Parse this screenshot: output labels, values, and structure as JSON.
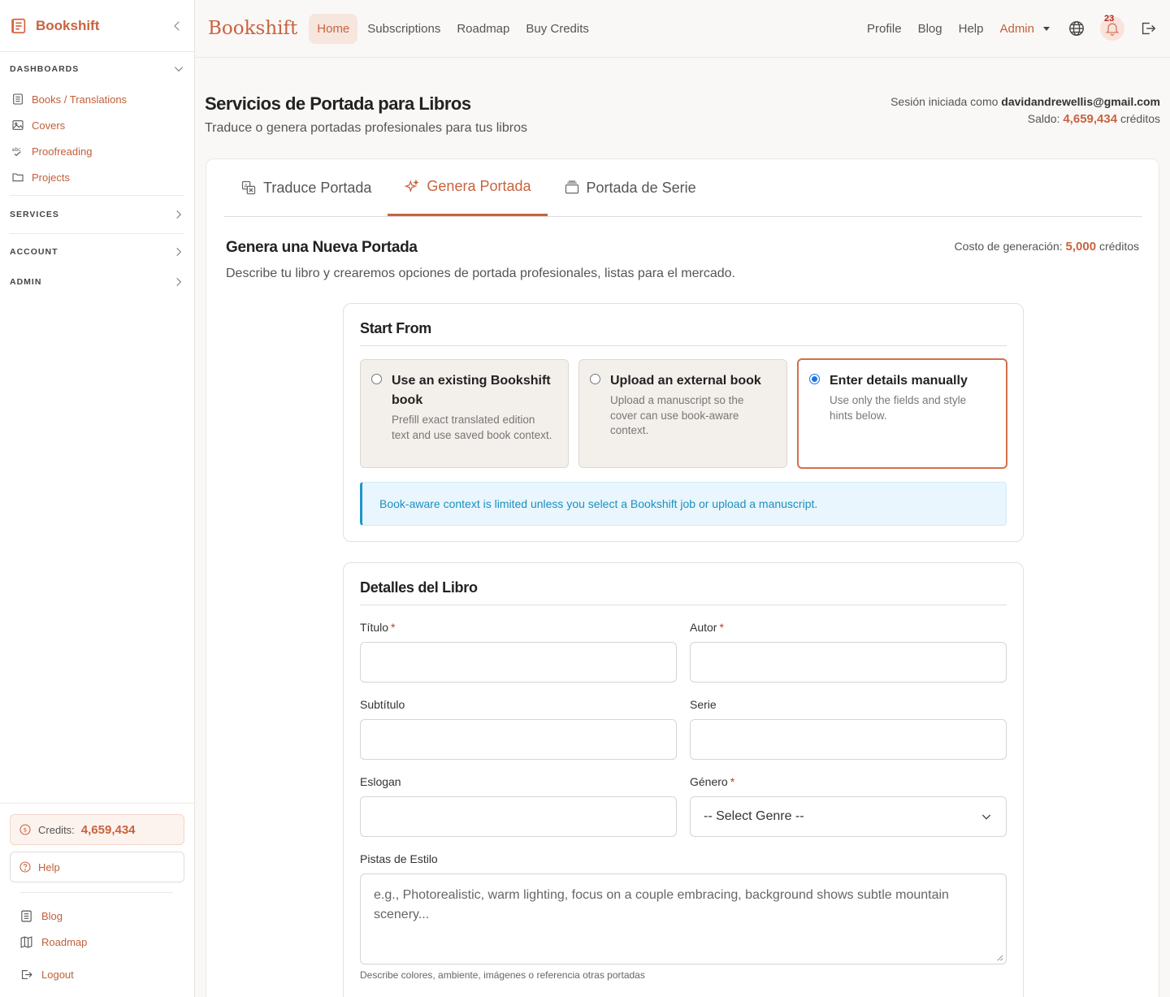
{
  "sidebar": {
    "brand": "Bookshift",
    "dashboards_label": "DASHBOARDS",
    "items": [
      {
        "label": "Books / Translations",
        "icon": "book-list-icon"
      },
      {
        "label": "Covers",
        "icon": "image-icon"
      },
      {
        "label": "Proofreading",
        "icon": "spellcheck-icon"
      },
      {
        "label": "Projects",
        "icon": "folder-icon"
      }
    ],
    "services_label": "SERVICES",
    "account_label": "ACCOUNT",
    "admin_label": "ADMIN",
    "credits_label": "Credits:",
    "credits_value": "4,659,434",
    "help_label": "Help",
    "footer_items": [
      {
        "label": "Blog",
        "icon": "blog-icon"
      },
      {
        "label": "Roadmap",
        "icon": "map-icon"
      },
      {
        "label": "Logout",
        "icon": "logout-icon"
      }
    ]
  },
  "topbar": {
    "brand": "Bookshift",
    "nav": [
      "Home",
      "Subscriptions",
      "Roadmap",
      "Buy Credits"
    ],
    "active_nav": "Home",
    "right_links": [
      "Profile",
      "Blog",
      "Help"
    ],
    "admin_label": "Admin",
    "notification_count": "23"
  },
  "header": {
    "title": "Servicios de Portada para Libros",
    "subtitle": "Traduce o genera portadas profesionales para tus libros",
    "session_prefix": "Sesión iniciada como",
    "session_email": "davidandrewellis@gmail.com",
    "balance_prefix": "Saldo:",
    "balance_value": "4,659,434",
    "balance_suffix": "créditos"
  },
  "tabs": [
    {
      "label": "Traduce Portada",
      "icon": "translate-icon"
    },
    {
      "label": "Genera Portada",
      "icon": "sparkle-icon",
      "active": true
    },
    {
      "label": "Portada de Serie",
      "icon": "stack-icon"
    }
  ],
  "generate": {
    "title": "Genera una Nueva Portada",
    "subtitle": "Describe tu libro y crearemos opciones de portada profesionales, listas para el mercado.",
    "cost_prefix": "Costo de generación:",
    "cost_value": "5,000",
    "cost_suffix": "créditos"
  },
  "start_from": {
    "title": "Start From",
    "options": [
      {
        "title": "Use an existing Bookshift book",
        "desc": "Prefill exact translated edition text and use saved book context.",
        "selected": false
      },
      {
        "title": "Upload an external book",
        "desc": "Upload a manuscript so the cover can use book-aware context.",
        "selected": false
      },
      {
        "title": "Enter details manually",
        "desc": "Use only the fields and style hints below.",
        "selected": true
      }
    ],
    "info": "Book-aware context is limited unless you select a Bookshift job or upload a manuscript."
  },
  "details": {
    "title": "Detalles del Libro",
    "titulo_label": "Título",
    "autor_label": "Autor",
    "subtitulo_label": "Subtítulo",
    "serie_label": "Serie",
    "eslogan_label": "Eslogan",
    "genero_label": "Género",
    "genero_value": "-- Select Genre --",
    "estilo_label": "Pistas de Estilo",
    "estilo_placeholder": "e.g., Photorealistic, warm lighting, focus on a couple embracing, background shows subtle mountain scenery...",
    "estilo_help": "Describe colores, ambiente, imágenes o referencia otras portadas",
    "required_mark": "*"
  }
}
